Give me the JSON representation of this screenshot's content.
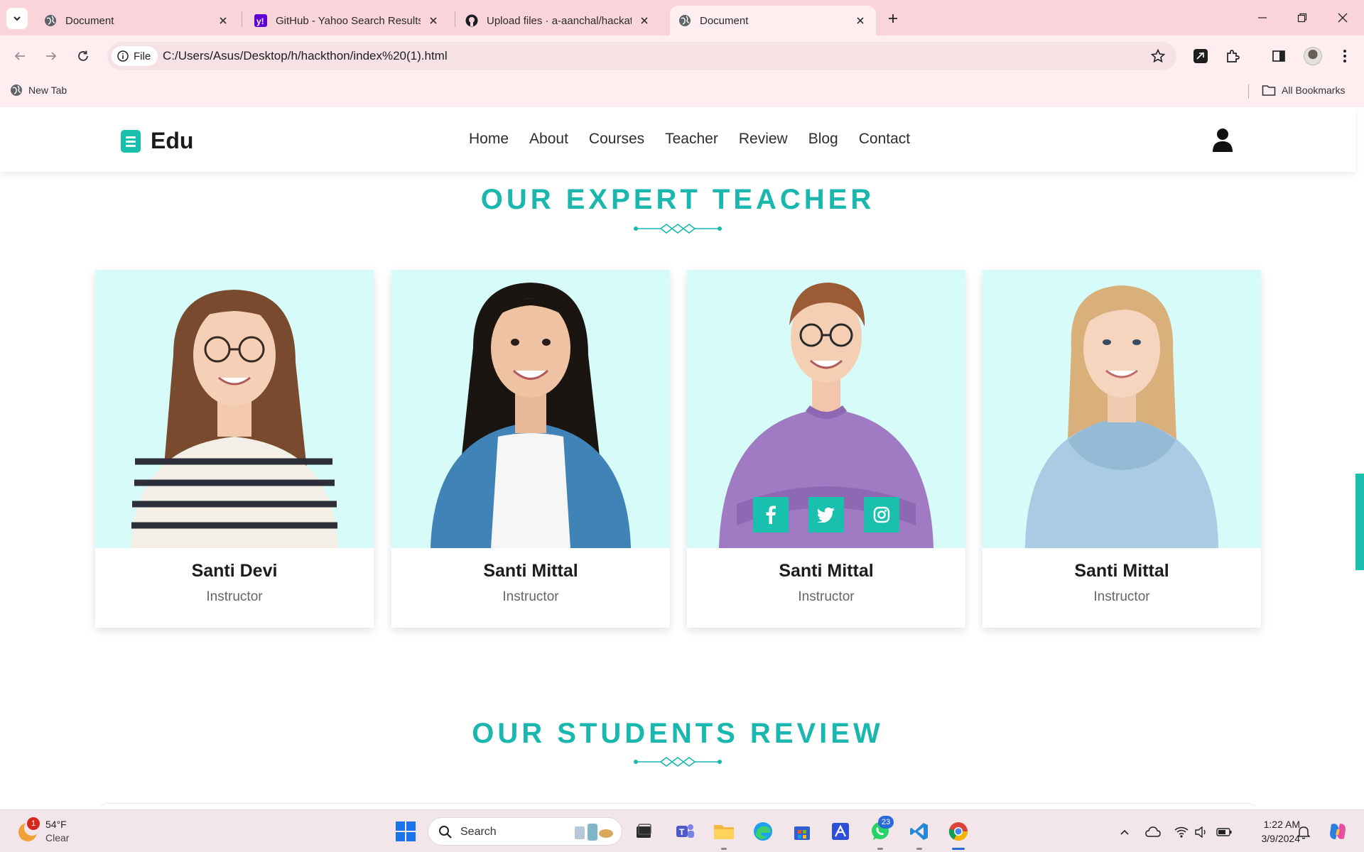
{
  "browser": {
    "tabs": [
      {
        "title": "Document",
        "active": false
      },
      {
        "title": "GitHub - Yahoo Search Results",
        "active": false
      },
      {
        "title": "Upload files · a-aanchal/hackath",
        "active": false
      },
      {
        "title": "Document",
        "active": true
      }
    ],
    "address": {
      "chip_label": "File",
      "url": "C:/Users/Asus/Desktop/h/hackthon/index%20(1).html"
    },
    "bookmarks": {
      "left_item": "New Tab",
      "right_item": "All Bookmarks"
    }
  },
  "site": {
    "logo_text": "Edu",
    "nav": [
      "Home",
      "About",
      "Courses",
      "Teacher",
      "Review",
      "Blog",
      "Contact"
    ],
    "accent_color": "#19c0ad"
  },
  "teachers_section": {
    "title": "OUR EXPERT TEACHER",
    "cards": [
      {
        "name": "Santi Devi",
        "role": "Instructor"
      },
      {
        "name": "Santi Mittal",
        "role": "Instructor"
      },
      {
        "name": "Santi Mittal",
        "role": "Instructor"
      },
      {
        "name": "Santi Mittal",
        "role": "Instructor"
      }
    ],
    "social_icons": [
      "facebook-icon",
      "twitter-icon",
      "instagram-icon"
    ]
  },
  "reviews_section": {
    "title": "OUR STUDENTS REVIEW"
  },
  "taskbar": {
    "weather": {
      "temp": "54°F",
      "condition": "Clear",
      "badge": "1"
    },
    "search_label": "Search",
    "whatsapp_badge": "23",
    "time": "1:22 AM",
    "date": "3/9/2024"
  }
}
